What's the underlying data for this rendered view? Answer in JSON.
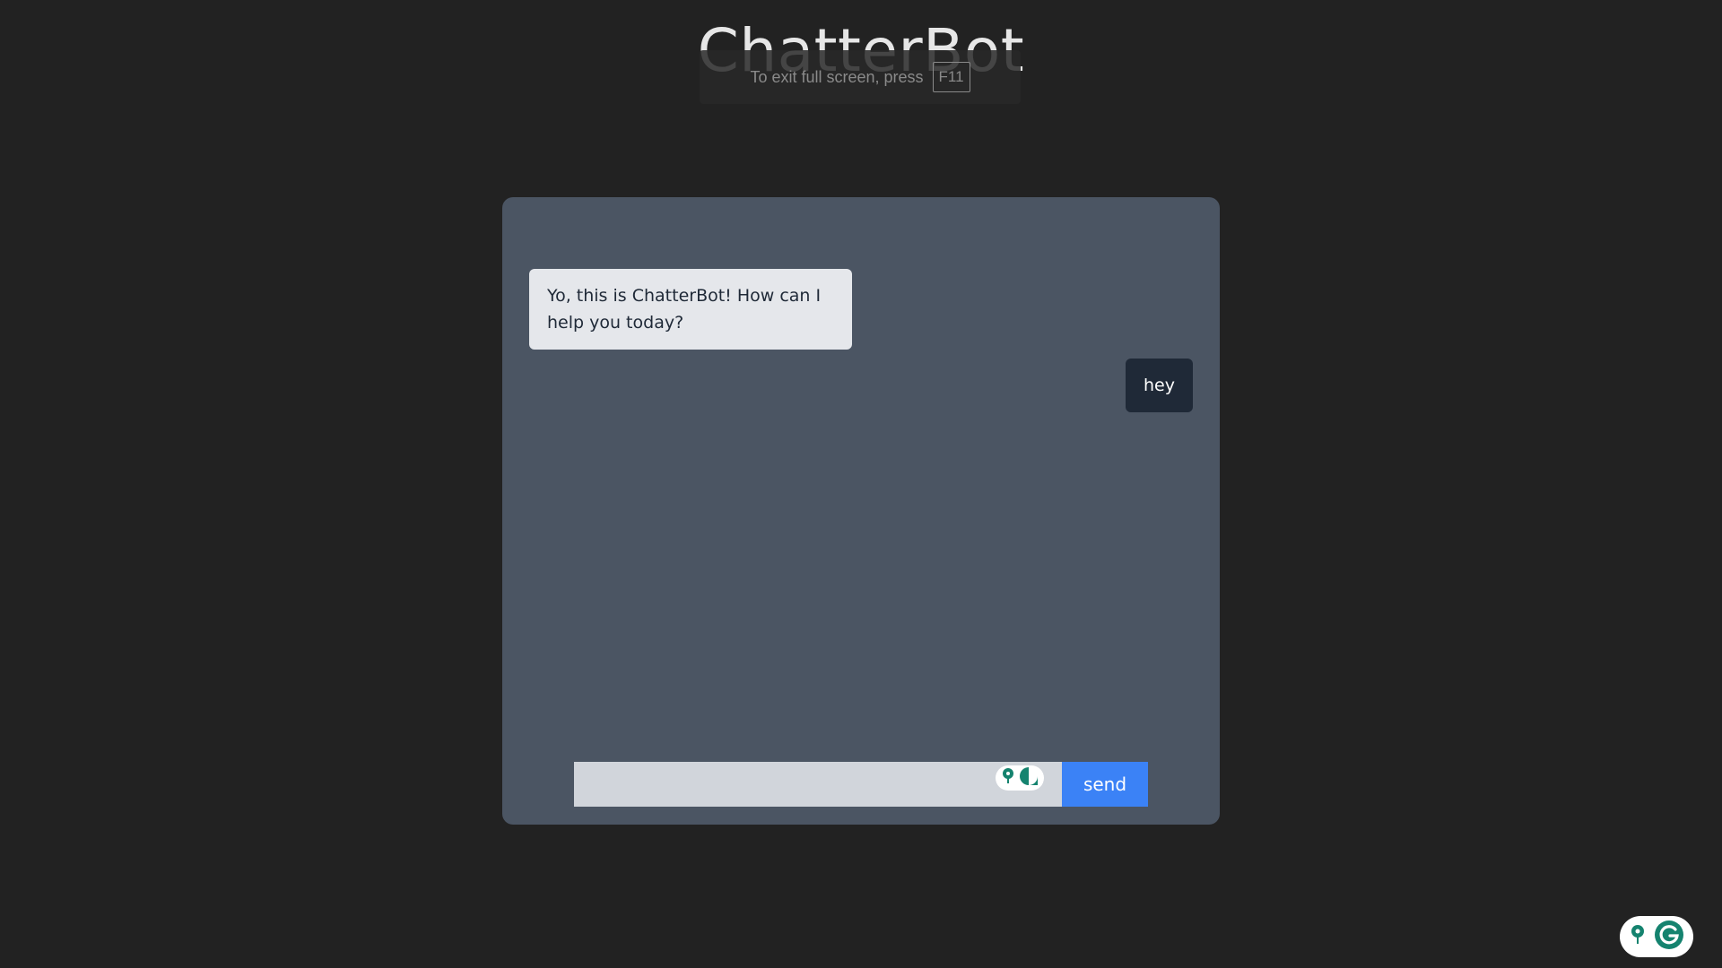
{
  "app": {
    "title": "ChatterBot"
  },
  "fullscreen_notice": {
    "text": "To exit full screen, press",
    "key": "F11"
  },
  "chat": {
    "messages": [
      {
        "sender": "bot",
        "text": "Yo, this is ChatterBot! How can I help you today?"
      },
      {
        "sender": "user",
        "text": "hey"
      }
    ]
  },
  "composer": {
    "input_value": "",
    "send_label": "send"
  },
  "colors": {
    "page_background": "#222222",
    "panel_background": "#4b5563",
    "bot_bubble": "#e5e7eb",
    "user_bubble": "#1f2937",
    "input_background": "#d1d5db",
    "send_button": "#3b82f6",
    "widget_accent": "#15836f"
  },
  "icons": {
    "inline_widget": [
      "lightbulb-icon",
      "grammarly-icon"
    ],
    "corner_widget": [
      "lightbulb-icon",
      "grammarly-icon"
    ]
  }
}
